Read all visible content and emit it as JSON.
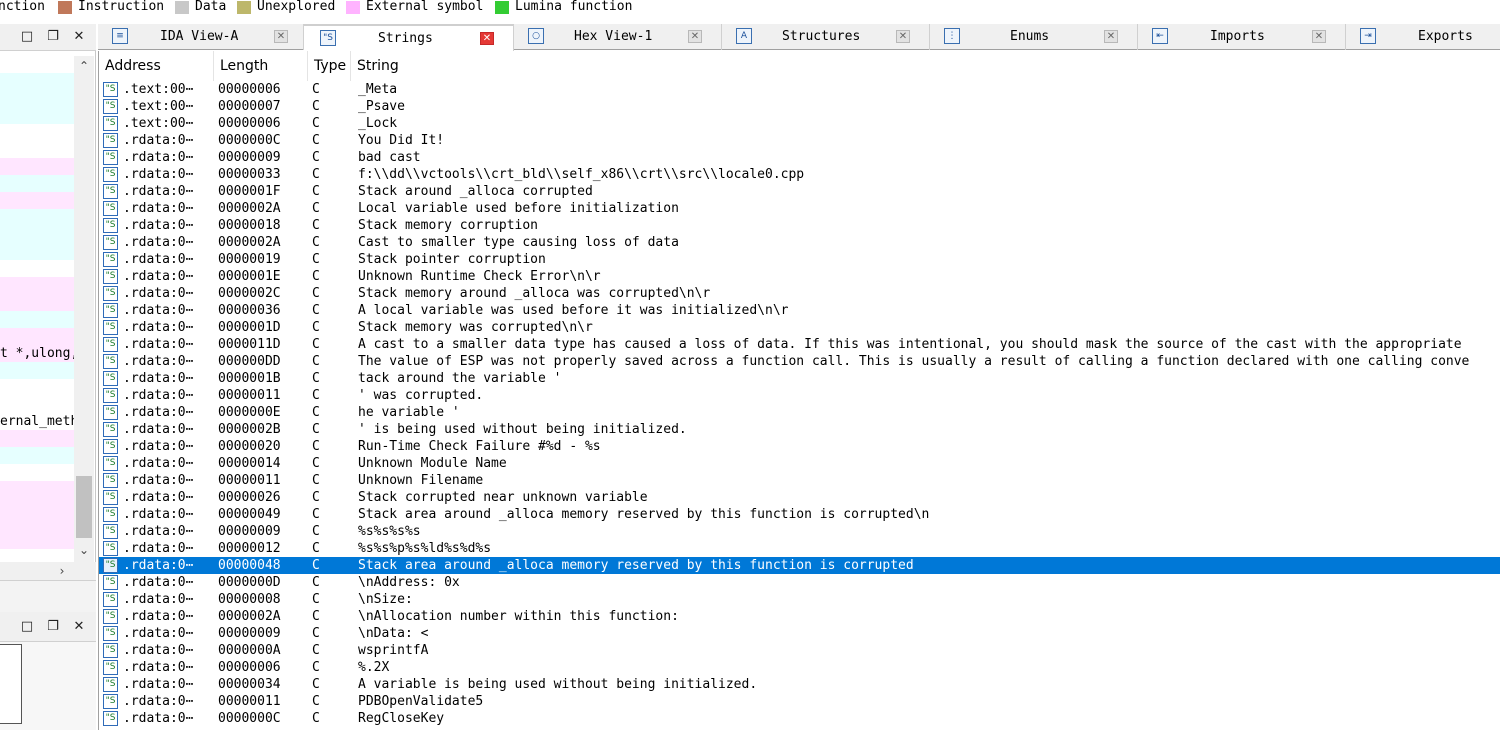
{
  "legend": [
    {
      "label": "nction",
      "color": ""
    },
    {
      "label": "Instruction",
      "color": "#c0785a"
    },
    {
      "label": "Data",
      "color": "#c8c8c8"
    },
    {
      "label": "Unexplored",
      "color": "#bdb76b"
    },
    {
      "label": "External symbol",
      "color": "#ffb3ff"
    },
    {
      "label": "Lumina function",
      "color": "#33cc33"
    }
  ],
  "left_pane": {
    "snippet_1": "t *,ulong,",
    "snippet_2": "ernal_meth",
    "row_colors": [
      "#ffffff",
      "#e6ffff",
      "#e6ffff",
      "#e6ffff",
      "#ffffff",
      "#ffffff",
      "#ffe6ff",
      "#e6ffff",
      "#ffe6ff",
      "#e6ffff",
      "#e6ffff",
      "#e6ffff",
      "#ffffff",
      "#ffe6ff",
      "#ffe6ff",
      "#e6ffff",
      "#ffe6ff",
      "#ffe6ff",
      "#e6ffff",
      "#ffffff",
      "#ffffff",
      "#ffffff",
      "#ffe6ff",
      "#e6ffff",
      "#ffffff",
      "#ffe6ff",
      "#ffe6ff",
      "#ffe6ff",
      "#ffe6ff",
      "#ffffff"
    ]
  },
  "tabs": [
    {
      "label": "IDA View-A",
      "icon": "disassembly-icon",
      "active": false
    },
    {
      "label": "Strings",
      "icon": "strings-icon",
      "active": true
    },
    {
      "label": "Hex View-1",
      "icon": "hex-view-icon",
      "active": false
    },
    {
      "label": "Structures",
      "icon": "structures-icon",
      "active": false
    },
    {
      "label": "Enums",
      "icon": "enums-icon",
      "active": false
    },
    {
      "label": "Imports",
      "icon": "imports-icon",
      "active": false
    },
    {
      "label": "Exports",
      "icon": "exports-icon",
      "active": false
    }
  ],
  "columns": [
    "Address",
    "Length",
    "Type",
    "String"
  ],
  "rows": [
    {
      "address": ".text:00⋯",
      "length": "00000006",
      "type": "C",
      "string": "_Meta"
    },
    {
      "address": ".text:00⋯",
      "length": "00000007",
      "type": "C",
      "string": "_Psave"
    },
    {
      "address": ".text:00⋯",
      "length": "00000006",
      "type": "C",
      "string": "_Lock"
    },
    {
      "address": ".rdata:0⋯",
      "length": "0000000C",
      "type": "C",
      "string": "You Did It!"
    },
    {
      "address": ".rdata:0⋯",
      "length": "00000009",
      "type": "C",
      "string": "bad cast"
    },
    {
      "address": ".rdata:0⋯",
      "length": "00000033",
      "type": "C",
      "string": "f:\\\\dd\\\\vctools\\\\crt_bld\\\\self_x86\\\\crt\\\\src\\\\locale0.cpp"
    },
    {
      "address": ".rdata:0⋯",
      "length": "0000001F",
      "type": "C",
      "string": "Stack around _alloca corrupted"
    },
    {
      "address": ".rdata:0⋯",
      "length": "0000002A",
      "type": "C",
      "string": "Local variable used before initialization"
    },
    {
      "address": ".rdata:0⋯",
      "length": "00000018",
      "type": "C",
      "string": "Stack memory corruption"
    },
    {
      "address": ".rdata:0⋯",
      "length": "0000002A",
      "type": "C",
      "string": "Cast to smaller type causing loss of data"
    },
    {
      "address": ".rdata:0⋯",
      "length": "00000019",
      "type": "C",
      "string": "Stack pointer corruption"
    },
    {
      "address": ".rdata:0⋯",
      "length": "0000001E",
      "type": "C",
      "string": "Unknown Runtime Check Error\\n\\r"
    },
    {
      "address": ".rdata:0⋯",
      "length": "0000002C",
      "type": "C",
      "string": "Stack memory around _alloca was corrupted\\n\\r"
    },
    {
      "address": ".rdata:0⋯",
      "length": "00000036",
      "type": "C",
      "string": "A local variable was used before it was initialized\\n\\r"
    },
    {
      "address": ".rdata:0⋯",
      "length": "0000001D",
      "type": "C",
      "string": "Stack memory was corrupted\\n\\r"
    },
    {
      "address": ".rdata:0⋯",
      "length": "0000011D",
      "type": "C",
      "string": "A cast to a smaller data type has caused a loss of data.  If this was intentional, you should mask the source of the cast with the appropriate"
    },
    {
      "address": ".rdata:0⋯",
      "length": "000000DD",
      "type": "C",
      "string": "The value of ESP was not properly saved across a function call.  This is usually a result of calling a function declared with one calling conve"
    },
    {
      "address": ".rdata:0⋯",
      "length": "0000001B",
      "type": "C",
      "string": "tack around the variable '"
    },
    {
      "address": ".rdata:0⋯",
      "length": "00000011",
      "type": "C",
      "string": "' was corrupted."
    },
    {
      "address": ".rdata:0⋯",
      "length": "0000000E",
      "type": "C",
      "string": "he variable '"
    },
    {
      "address": ".rdata:0⋯",
      "length": "0000002B",
      "type": "C",
      "string": "' is being used without being initialized."
    },
    {
      "address": ".rdata:0⋯",
      "length": "00000020",
      "type": "C",
      "string": "Run-Time Check Failure #%d - %s"
    },
    {
      "address": ".rdata:0⋯",
      "length": "00000014",
      "type": "C",
      "string": "Unknown Module Name"
    },
    {
      "address": ".rdata:0⋯",
      "length": "00000011",
      "type": "C",
      "string": "Unknown Filename"
    },
    {
      "address": ".rdata:0⋯",
      "length": "00000026",
      "type": "C",
      "string": "Stack corrupted near unknown variable"
    },
    {
      "address": ".rdata:0⋯",
      "length": "00000049",
      "type": "C",
      "string": "Stack area around _alloca memory reserved by this function is corrupted\\n"
    },
    {
      "address": ".rdata:0⋯",
      "length": "00000009",
      "type": "C",
      "string": "%s%s%s%s"
    },
    {
      "address": ".rdata:0⋯",
      "length": "00000012",
      "type": "C",
      "string": "%s%s%p%s%ld%s%d%s"
    },
    {
      "address": ".rdata:0⋯",
      "length": "00000048",
      "type": "C",
      "string": "Stack area around _alloca memory reserved by this function is corrupted",
      "selected": true
    },
    {
      "address": ".rdata:0⋯",
      "length": "0000000D",
      "type": "C",
      "string": "\\nAddress: 0x"
    },
    {
      "address": ".rdata:0⋯",
      "length": "00000008",
      "type": "C",
      "string": "\\nSize:"
    },
    {
      "address": ".rdata:0⋯",
      "length": "0000002A",
      "type": "C",
      "string": "\\nAllocation number within this function:"
    },
    {
      "address": ".rdata:0⋯",
      "length": "00000009",
      "type": "C",
      "string": "\\nData: <"
    },
    {
      "address": ".rdata:0⋯",
      "length": "0000000A",
      "type": "C",
      "string": "wsprintfA"
    },
    {
      "address": ".rdata:0⋯",
      "length": "00000006",
      "type": "C",
      "string": "%.2X"
    },
    {
      "address": ".rdata:0⋯",
      "length": "00000034",
      "type": "C",
      "string": "A variable is being used without being initialized."
    },
    {
      "address": ".rdata:0⋯",
      "length": "00000011",
      "type": "C",
      "string": "PDBOpenValidate5"
    },
    {
      "address": ".rdata:0⋯",
      "length": "0000000C",
      "type": "C",
      "string": "RegCloseKey"
    }
  ],
  "colors": {
    "selection": "#0078d7",
    "tab_close_active": "#e53935"
  }
}
